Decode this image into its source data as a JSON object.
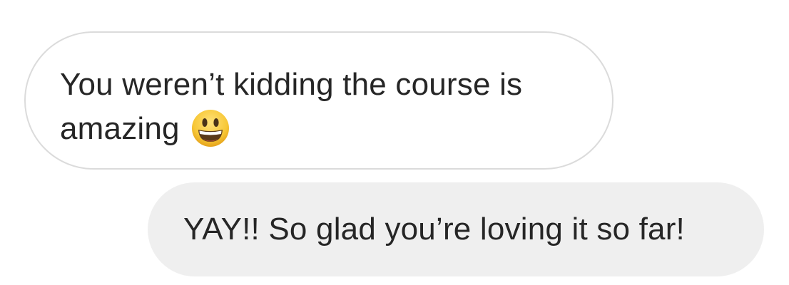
{
  "conversation": {
    "messages": [
      {
        "direction": "received",
        "lines": [
          "You weren’t kidding the course is",
          "amazing"
        ],
        "emoji": "grinning-face-icon"
      },
      {
        "direction": "sent",
        "text": "YAY!! So glad you’re loving it so far!"
      }
    ]
  },
  "colors": {
    "text": "#262626",
    "received_bubble_border": "#dbdbdb",
    "received_bubble_background": "#ffffff",
    "sent_bubble_background": "#efefef",
    "emoji_face": "#f7c736"
  }
}
